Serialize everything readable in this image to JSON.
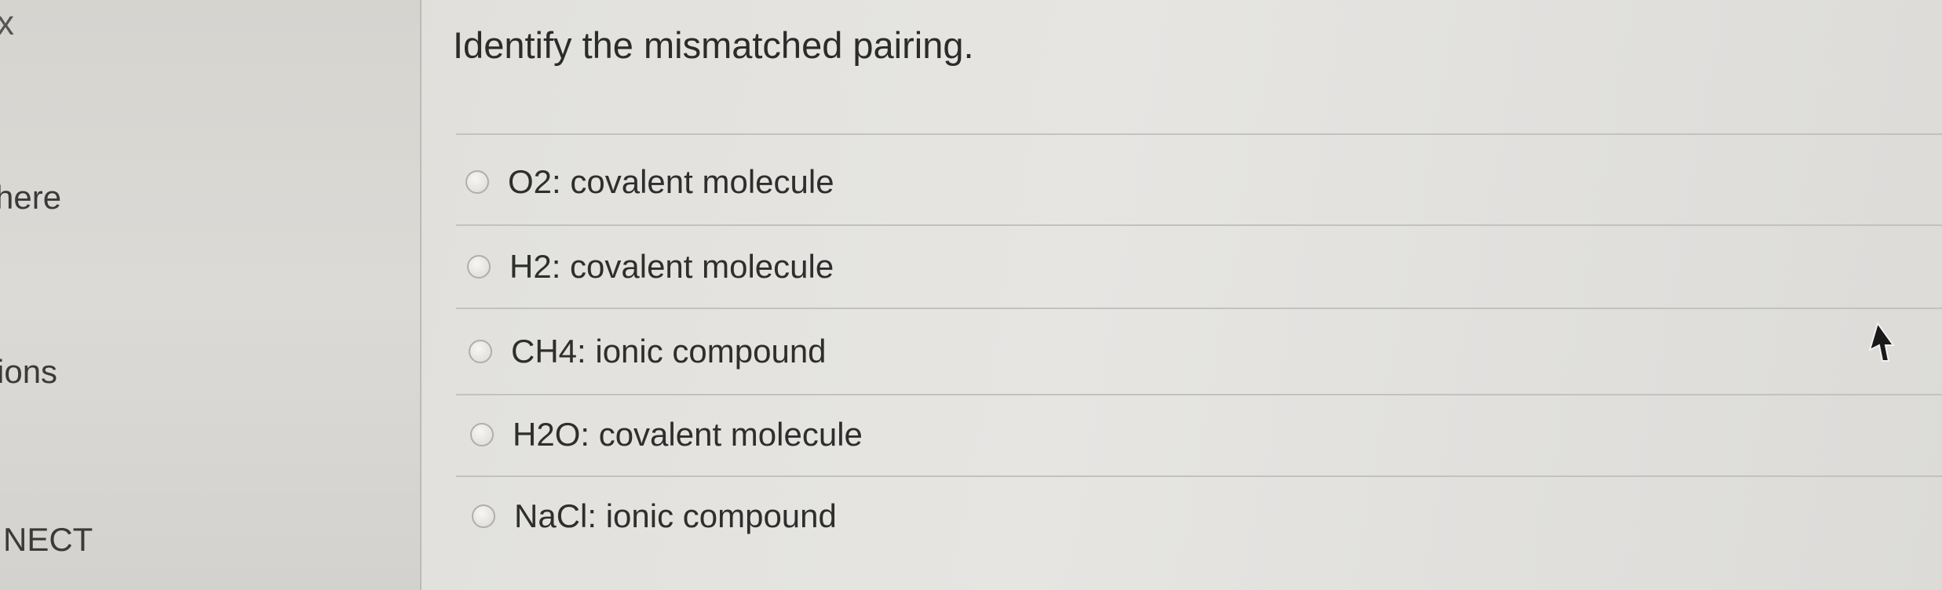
{
  "sidebar": {
    "close_glyph": "x",
    "items": [
      {
        "label": "here"
      },
      {
        "label": "ions"
      },
      {
        "label": "NECT"
      }
    ]
  },
  "question": {
    "prompt": "Identify the mismatched pairing.",
    "options": [
      {
        "label": "O2: covalent molecule"
      },
      {
        "label": "H2: covalent molecule"
      },
      {
        "label": "CH4: ionic compound"
      },
      {
        "label": "H2O: covalent molecule"
      },
      {
        "label": "NaCl: ionic compound"
      }
    ]
  },
  "icons": {
    "close": "close-icon",
    "radio": "radio-button-icon",
    "cursor": "mouse-pointer-icon"
  }
}
